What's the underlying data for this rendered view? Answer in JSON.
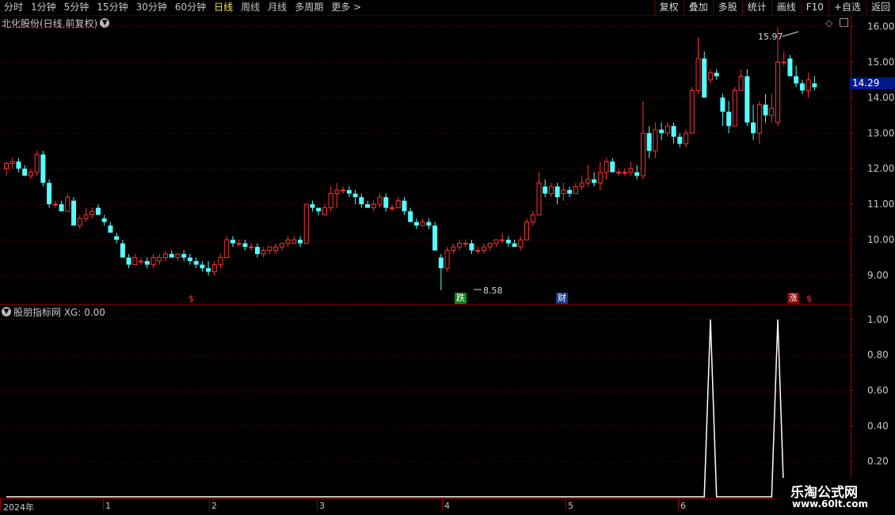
{
  "periods": [
    "分时",
    "1分钟",
    "5分钟",
    "15分钟",
    "30分钟",
    "60分钟",
    "日线",
    "周线",
    "月线",
    "多周期",
    "更多 >"
  ],
  "active_period": "日线",
  "right_buttons": [
    "复权",
    "叠加",
    "多股",
    "统计",
    "画线",
    "F10",
    "+自选",
    "返回"
  ],
  "stock_title": "北化股份(日线,前复权)",
  "indicator_title": "股朋指标网 XG: 0.00",
  "current_price": "14.29",
  "high_label": "15.97",
  "low_label": "8.58",
  "markers": [
    "$",
    "跌",
    "财",
    "涨",
    "$"
  ],
  "x_labels": [
    "2024年",
    "1",
    "2",
    "3",
    "4",
    "5",
    "6"
  ],
  "watermark": {
    "line1": "乐淘公式网",
    "line2": "www.60lt.com"
  },
  "colors": {
    "up": "#ff3232",
    "down": "#54ffff",
    "grid": "#8b0000",
    "axis": "#a00000",
    "marker_fall": "#0b8a1a",
    "marker_rise": "#8a0000",
    "marker_fin": "#1a3a8a"
  },
  "chart_data": [
    {
      "type": "candlestick",
      "title": "北化股份(日线,前复权)",
      "y_ticks": [
        9.0,
        10.0,
        11.0,
        12.0,
        13.0,
        14.0,
        15.0,
        16.0
      ],
      "ylim": [
        8.2,
        16.3
      ],
      "ohlc": [
        [
          12.0,
          12.2,
          11.8,
          12.15
        ],
        [
          12.15,
          12.3,
          12.0,
          12.2
        ],
        [
          12.2,
          12.3,
          11.9,
          12.0
        ],
        [
          12.0,
          12.1,
          11.8,
          11.8
        ],
        [
          11.8,
          12.0,
          11.7,
          11.9
        ],
        [
          11.9,
          12.5,
          11.8,
          12.4
        ],
        [
          12.4,
          12.5,
          11.5,
          11.6
        ],
        [
          11.6,
          11.7,
          10.9,
          11.0
        ],
        [
          11.0,
          11.1,
          10.9,
          11.0
        ],
        [
          11.0,
          11.1,
          10.8,
          10.8
        ],
        [
          10.8,
          11.3,
          10.8,
          11.2
        ],
        [
          11.1,
          11.2,
          10.4,
          10.4
        ],
        [
          10.4,
          10.7,
          10.3,
          10.6
        ],
        [
          10.6,
          10.9,
          10.5,
          10.7
        ],
        [
          10.7,
          10.9,
          10.6,
          10.8
        ],
        [
          10.9,
          11.0,
          10.7,
          10.7
        ],
        [
          10.6,
          10.7,
          10.4,
          10.5
        ],
        [
          10.4,
          10.5,
          10.2,
          10.2
        ],
        [
          10.1,
          10.2,
          9.9,
          10.0
        ],
        [
          9.9,
          10.0,
          9.5,
          9.5
        ],
        [
          9.5,
          9.6,
          9.2,
          9.3
        ],
        [
          9.3,
          9.6,
          9.3,
          9.5
        ],
        [
          9.4,
          9.5,
          9.3,
          9.4
        ],
        [
          9.4,
          9.5,
          9.2,
          9.3
        ],
        [
          9.3,
          9.6,
          9.2,
          9.5
        ],
        [
          9.4,
          9.6,
          9.3,
          9.5
        ],
        [
          9.5,
          9.7,
          9.4,
          9.6
        ],
        [
          9.6,
          9.7,
          9.5,
          9.5
        ],
        [
          9.5,
          9.6,
          9.4,
          9.6
        ],
        [
          9.6,
          9.7,
          9.4,
          9.5
        ],
        [
          9.5,
          9.6,
          9.3,
          9.4
        ],
        [
          9.4,
          9.5,
          9.2,
          9.3
        ],
        [
          9.3,
          9.4,
          9.1,
          9.2
        ],
        [
          9.2,
          9.4,
          9.0,
          9.1
        ],
        [
          9.1,
          9.4,
          9.0,
          9.3
        ],
        [
          9.3,
          9.6,
          9.2,
          9.5
        ],
        [
          9.5,
          10.1,
          9.5,
          10.0
        ],
        [
          10.0,
          10.1,
          9.8,
          9.9
        ],
        [
          9.9,
          10.0,
          9.8,
          9.9
        ],
        [
          9.9,
          10.0,
          9.7,
          9.8
        ],
        [
          9.8,
          9.9,
          9.7,
          9.8
        ],
        [
          9.8,
          9.9,
          9.5,
          9.6
        ],
        [
          9.6,
          9.8,
          9.5,
          9.7
        ],
        [
          9.7,
          9.8,
          9.6,
          9.8
        ],
        [
          9.7,
          9.9,
          9.6,
          9.8
        ],
        [
          9.8,
          9.9,
          9.7,
          9.9
        ],
        [
          9.9,
          10.1,
          9.8,
          10.0
        ],
        [
          9.9,
          10.1,
          9.9,
          10.0
        ],
        [
          10.0,
          10.1,
          9.8,
          9.9
        ],
        [
          9.9,
          11.0,
          9.9,
          11.0
        ],
        [
          11.0,
          11.1,
          10.8,
          10.9
        ],
        [
          10.9,
          10.9,
          10.7,
          10.8
        ],
        [
          10.7,
          11.0,
          10.7,
          10.9
        ],
        [
          10.9,
          11.5,
          10.8,
          11.3
        ],
        [
          11.3,
          11.6,
          10.9,
          11.4
        ],
        [
          11.4,
          11.5,
          11.3,
          11.4
        ],
        [
          11.4,
          11.5,
          11.2,
          11.3
        ],
        [
          11.3,
          11.4,
          11.0,
          11.2
        ],
        [
          11.2,
          11.3,
          10.9,
          11.0
        ],
        [
          11.0,
          11.1,
          10.9,
          10.9
        ],
        [
          10.9,
          11.1,
          10.8,
          11.0
        ],
        [
          11.0,
          11.3,
          10.9,
          11.2
        ],
        [
          11.2,
          11.3,
          10.8,
          10.9
        ],
        [
          10.9,
          11.0,
          10.8,
          10.9
        ],
        [
          10.9,
          11.2,
          10.9,
          11.1
        ],
        [
          11.1,
          11.2,
          10.7,
          10.8
        ],
        [
          10.8,
          10.9,
          10.5,
          10.5
        ],
        [
          10.5,
          10.6,
          10.3,
          10.4
        ],
        [
          10.4,
          10.6,
          10.4,
          10.5
        ],
        [
          10.5,
          10.6,
          10.3,
          10.4
        ],
        [
          10.4,
          10.5,
          9.7,
          9.7
        ],
        [
          9.5,
          9.6,
          8.58,
          9.2
        ],
        [
          9.2,
          9.8,
          9.1,
          9.7
        ],
        [
          9.7,
          9.9,
          9.6,
          9.8
        ],
        [
          9.8,
          10.0,
          9.7,
          9.9
        ],
        [
          9.9,
          10.0,
          9.8,
          9.9
        ],
        [
          9.9,
          10.0,
          9.6,
          9.7
        ],
        [
          9.7,
          9.8,
          9.6,
          9.7
        ],
        [
          9.7,
          9.9,
          9.6,
          9.8
        ],
        [
          9.8,
          9.9,
          9.7,
          9.9
        ],
        [
          9.9,
          10.0,
          9.8,
          10.0
        ],
        [
          10.0,
          10.2,
          9.9,
          10.0
        ],
        [
          10.0,
          10.1,
          9.8,
          9.9
        ],
        [
          9.9,
          10.0,
          9.8,
          9.8
        ],
        [
          9.8,
          10.1,
          9.7,
          10.0
        ],
        [
          10.0,
          10.6,
          10.0,
          10.5
        ],
        [
          10.5,
          10.8,
          10.4,
          10.7
        ],
        [
          10.7,
          11.9,
          10.7,
          11.6
        ],
        [
          11.5,
          11.7,
          11.2,
          11.3
        ],
        [
          11.3,
          11.6,
          11.2,
          11.5
        ],
        [
          11.5,
          11.6,
          11.0,
          11.2
        ],
        [
          11.3,
          11.6,
          11.1,
          11.4
        ],
        [
          11.4,
          11.5,
          11.2,
          11.3
        ],
        [
          11.3,
          11.6,
          11.3,
          11.5
        ],
        [
          11.5,
          11.8,
          11.4,
          11.6
        ],
        [
          11.6,
          12.1,
          11.5,
          11.7
        ],
        [
          11.7,
          11.9,
          11.5,
          11.6
        ],
        [
          11.6,
          12.2,
          11.4,
          11.9
        ],
        [
          11.9,
          12.3,
          11.7,
          12.2
        ],
        [
          12.2,
          12.3,
          11.9,
          11.9
        ],
        [
          11.9,
          12.0,
          11.8,
          11.9
        ],
        [
          11.9,
          12.0,
          11.8,
          11.9
        ],
        [
          11.9,
          12.2,
          11.8,
          12.0
        ],
        [
          11.9,
          12.1,
          11.7,
          11.8
        ],
        [
          11.8,
          13.9,
          11.7,
          13.0
        ],
        [
          13.0,
          13.2,
          12.3,
          12.5
        ],
        [
          12.5,
          13.3,
          12.3,
          13.1
        ],
        [
          13.1,
          13.3,
          12.8,
          13.0
        ],
        [
          13.0,
          13.3,
          12.9,
          13.2
        ],
        [
          13.2,
          13.3,
          12.7,
          12.9
        ],
        [
          12.9,
          13.0,
          12.6,
          12.7
        ],
        [
          12.7,
          13.1,
          12.6,
          13.0
        ],
        [
          13.0,
          14.3,
          13.0,
          14.2
        ],
        [
          14.2,
          15.7,
          14.1,
          15.1
        ],
        [
          15.1,
          15.3,
          14.0,
          14.0
        ],
        [
          14.5,
          14.8,
          14.4,
          14.7
        ],
        [
          14.7,
          14.8,
          14.5,
          14.6
        ],
        [
          14.0,
          14.1,
          13.2,
          13.6
        ],
        [
          13.6,
          13.9,
          13.0,
          13.2
        ],
        [
          13.2,
          14.3,
          13.2,
          14.2
        ],
        [
          14.2,
          14.8,
          14.2,
          14.6
        ],
        [
          14.6,
          14.8,
          13.2,
          13.3
        ],
        [
          13.3,
          13.8,
          12.8,
          13.0
        ],
        [
          13.0,
          13.9,
          12.7,
          13.8
        ],
        [
          13.8,
          14.1,
          13.3,
          13.5
        ],
        [
          13.5,
          14.1,
          13.3,
          13.7
        ],
        [
          13.3,
          15.97,
          13.2,
          15.0
        ],
        [
          15.0,
          15.3,
          14.9,
          15.0
        ],
        [
          15.1,
          15.2,
          14.6,
          14.6
        ],
        [
          14.6,
          14.9,
          14.3,
          14.4
        ],
        [
          14.4,
          14.5,
          14.1,
          14.2
        ],
        [
          14.2,
          14.7,
          14.0,
          14.5
        ],
        [
          14.4,
          14.6,
          14.2,
          14.29
        ]
      ]
    },
    {
      "type": "line",
      "title": "股朋指标网 XG: 0.00",
      "y_ticks": [
        0.2,
        0.4,
        0.6,
        0.8,
        1.0
      ],
      "ylim": [
        0.0,
        1.08
      ],
      "values": [
        0,
        0,
        0,
        0,
        0,
        0,
        0,
        0,
        0,
        0,
        0,
        0,
        0,
        0,
        0,
        0,
        0,
        0,
        0,
        0,
        0,
        0,
        0,
        0,
        0,
        0,
        0,
        0,
        0,
        0,
        0,
        0,
        0,
        0,
        0,
        0,
        0,
        0,
        0,
        0,
        0,
        0,
        0,
        0,
        0,
        0,
        0,
        0,
        0,
        0,
        0,
        0,
        0,
        0,
        0,
        0,
        0,
        0,
        0,
        0,
        0,
        0,
        0,
        0,
        0,
        0,
        0,
        0,
        0,
        0,
        0,
        0,
        0,
        0,
        0,
        0,
        0,
        0,
        0,
        0,
        0,
        0,
        0,
        0,
        0,
        0,
        0,
        0,
        0,
        0,
        0,
        0,
        0,
        0,
        0,
        0,
        0,
        0,
        0,
        0,
        0,
        0,
        0,
        0,
        0,
        0,
        0,
        0,
        0,
        0,
        0,
        0,
        0,
        0,
        0,
        1,
        0,
        0,
        0,
        0,
        0,
        0,
        0,
        0,
        0,
        0,
        1,
        0,
        0,
        0,
        0,
        0,
        0,
        0
      ]
    }
  ]
}
